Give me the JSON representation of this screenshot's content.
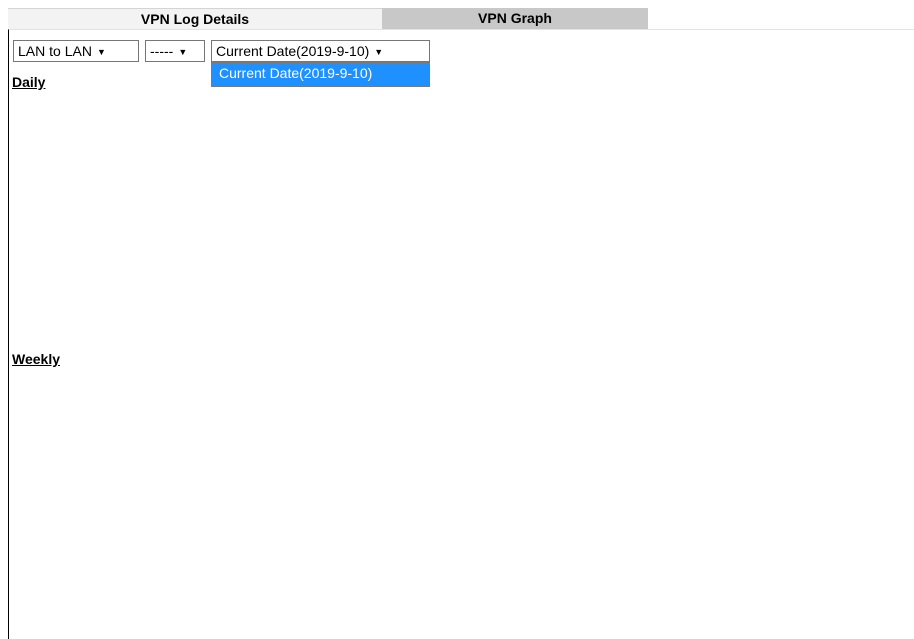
{
  "tabs": [
    {
      "label": "VPN Log Details",
      "active": true
    },
    {
      "label": "VPN Graph",
      "active": false
    }
  ],
  "filters": {
    "type": {
      "value": "LAN to LAN"
    },
    "profile": {
      "value": "-----"
    },
    "date": {
      "value": "Current Date(2019-9-10)",
      "options": [
        "Current Date(2019-9-10)"
      ]
    }
  },
  "dropdown": {
    "highlighted_option": "Current Date(2019-9-10)"
  },
  "sections": {
    "daily": "Daily",
    "weekly": "Weekly"
  },
  "icons": {
    "select_arrow": "triangle-down-icon"
  },
  "colors": {
    "active_tab_bg": "#f3f3f3",
    "inactive_tab_bg": "#c8c8c8",
    "highlight": "#1e90ff"
  }
}
